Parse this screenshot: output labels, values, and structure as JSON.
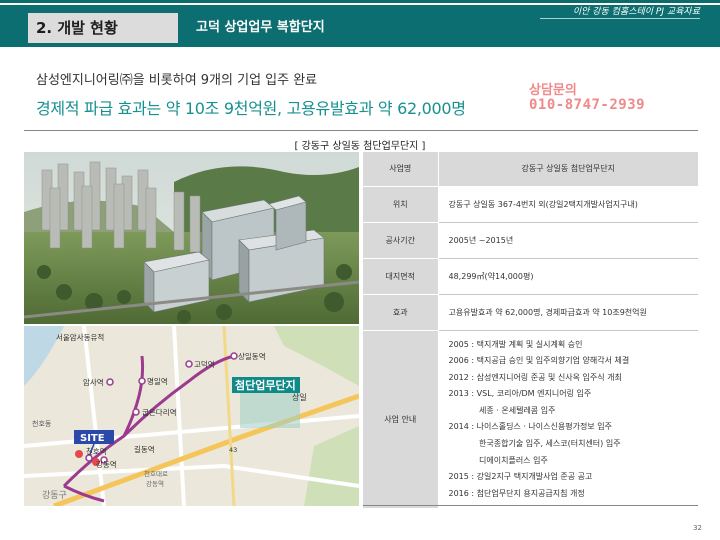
{
  "header": {
    "section_title": "2. 개발 현황",
    "subtitle": "고덕 상업업무 복합단지",
    "doc_label": "이안 강동 컴홈스테이 PJ 교육자료"
  },
  "intro": {
    "line1": "삼성엔지니어링㈜을 비롯하여 9개의 기업 입주 완료",
    "line2": "경제적 파급 효과는 약 10조 9천억원, 고용유발효과 약 62,000명"
  },
  "consult": {
    "label": "상담문의",
    "phone": "010-8747-2939"
  },
  "caption": "[ 강동구 상일동 첨단업무단지 ]",
  "map": {
    "labels": {
      "heritage": "서울암사동유적",
      "godeok": "고덕역",
      "sangil": "상일동역",
      "amsa": "암사역",
      "myeongil": "명일역",
      "gubeundari": "굽은다리역",
      "cheonho": "천호역",
      "gangdong": "강동역",
      "gil": "길동역",
      "district": "강동구",
      "site_big": "첨단업무단지",
      "ic": "상일",
      "hw43": "43",
      "site": "SITE",
      "dist_small": "천호동",
      "line_small": "천호대로",
      "line_small2": "강동역"
    }
  },
  "table": {
    "head": {
      "key": "사업명",
      "value": "강동구 상일동 첨단업무단지"
    },
    "rows": [
      {
        "key": "위치",
        "value": "강동구 상일동 367-4번지 외(강일2택지개발사업지구내)"
      },
      {
        "key": "공사기간",
        "value": "2005년 ~2015년"
      },
      {
        "key": "대지면적",
        "value": "48,299㎡(약14,000평)"
      },
      {
        "key": "효과",
        "value": "고용유발효과 약 62,000명, 경제파급효과 약 10조9천억원"
      }
    ],
    "history_key": "사업 안내",
    "history": [
      "2005 : 택지개발 계획 및 실시계획 승인",
      "2006 : 택지공급 승인 및 입주의향기업 양해각서 체결",
      "2012 : 삼성엔지니어링 준공 및 신사옥 입주식 개최",
      "2013 : VSL, 코리아/DM 엔지니어링 입주",
      "            세종 · 온세텔레콤 입주",
      "2014 : 나이스홀딩스 · 나이스신용평가정보 입주",
      "            한국종합기술 입주, 세스코(터치센터) 입주",
      "            디에이치플러스 입주",
      "2015 : 강일2지구 택지개발사업 준공 공고",
      "2016 : 첨단업무단지 용지공급지침 개정"
    ]
  },
  "page_number": "32"
}
